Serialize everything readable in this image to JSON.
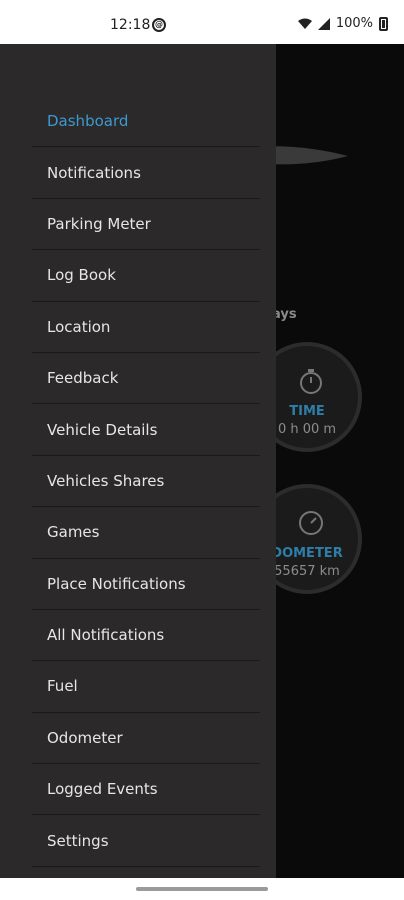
{
  "status_bar": {
    "time": "12:18",
    "battery": "100%",
    "icons": [
      "at-icon",
      "wifi-icon",
      "signal-icon",
      "battery-icon"
    ]
  },
  "background": {
    "days_label": "ays",
    "time_gauge": {
      "label": "TIME",
      "value": "0 h 00 m",
      "icon": "stopwatch-icon"
    },
    "odometer_gauge": {
      "label": "DOMETER",
      "value": "55657 km",
      "icon": "speedometer-icon"
    }
  },
  "drawer": {
    "accent_color": "#3d9ad1",
    "items": [
      {
        "label": "Dashboard",
        "active": true
      },
      {
        "label": "Notifications"
      },
      {
        "label": "Parking Meter"
      },
      {
        "label": "Log Book"
      },
      {
        "label": "Location"
      },
      {
        "label": "Feedback"
      },
      {
        "label": "Vehicle Details"
      },
      {
        "label": "Vehicles Shares"
      },
      {
        "label": "Games"
      },
      {
        "label": "Place Notifications"
      },
      {
        "label": "All Notifications"
      },
      {
        "label": "Fuel"
      },
      {
        "label": "Odometer"
      },
      {
        "label": "Logged Events"
      },
      {
        "label": "Settings"
      }
    ]
  }
}
